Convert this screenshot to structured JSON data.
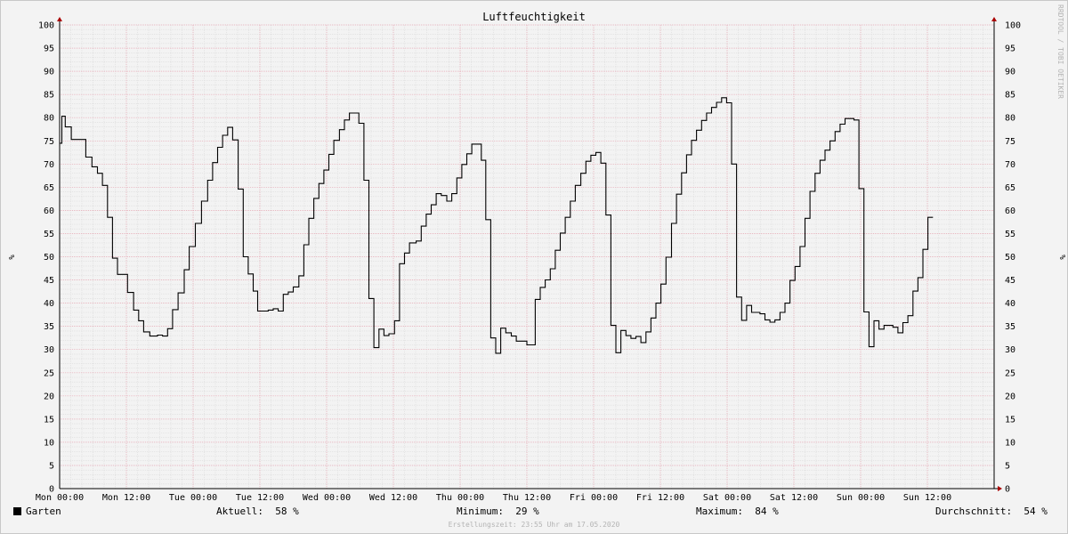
{
  "chart_data": {
    "type": "line",
    "title": "Luftfeuchtigkeit",
    "ylabel": "%",
    "ylim": [
      0,
      100
    ],
    "y_ticks": [
      0,
      5,
      10,
      15,
      20,
      25,
      30,
      35,
      40,
      45,
      50,
      55,
      60,
      65,
      70,
      75,
      80,
      85,
      90,
      95,
      100
    ],
    "x_tick_labels": [
      "Mon 00:00",
      "Mon 12:00",
      "Tue 00:00",
      "Tue 12:00",
      "Wed 00:00",
      "Wed 12:00",
      "Thu 00:00",
      "Thu 12:00",
      "Fri 00:00",
      "Fri 12:00",
      "Sat 00:00",
      "Sat 12:00",
      "Sun 00:00",
      "Sun 12:00"
    ],
    "x_unit": "hours since Mon 00:00",
    "xlim": [
      0,
      168
    ],
    "grid": true,
    "series": [
      {
        "name": "Garten",
        "color": "#000000",
        "step": true,
        "points": [
          [
            0,
            74.5
          ],
          [
            0.4,
            80.3
          ],
          [
            1.0,
            78.0
          ],
          [
            2.1,
            75.3
          ],
          [
            4.7,
            71.5
          ],
          [
            5.8,
            69.4
          ],
          [
            6.8,
            68.0
          ],
          [
            7.7,
            65.4
          ],
          [
            8.6,
            58.5
          ],
          [
            9.5,
            49.7
          ],
          [
            10.4,
            46.2
          ],
          [
            12.2,
            42.3
          ],
          [
            13.3,
            38.5
          ],
          [
            14.2,
            36.2
          ],
          [
            15.1,
            33.8
          ],
          [
            16.2,
            32.9
          ],
          [
            17.6,
            33.1
          ],
          [
            18.5,
            32.9
          ],
          [
            19.4,
            34.5
          ],
          [
            20.3,
            38.6
          ],
          [
            21.3,
            42.2
          ],
          [
            22.4,
            47.2
          ],
          [
            23.3,
            52.2
          ],
          [
            24.4,
            57.2
          ],
          [
            25.5,
            62.0
          ],
          [
            26.6,
            66.5
          ],
          [
            27.5,
            70.3
          ],
          [
            28.4,
            73.6
          ],
          [
            29.3,
            76.2
          ],
          [
            30.2,
            77.9
          ],
          [
            31.1,
            75.2
          ],
          [
            32.1,
            64.6
          ],
          [
            33.0,
            50.0
          ],
          [
            33.9,
            46.3
          ],
          [
            34.8,
            42.6
          ],
          [
            35.6,
            38.3
          ],
          [
            37.5,
            38.5
          ],
          [
            38.4,
            38.8
          ],
          [
            39.3,
            38.3
          ],
          [
            40.2,
            41.9
          ],
          [
            41.1,
            42.4
          ],
          [
            42.0,
            43.5
          ],
          [
            43.0,
            45.9
          ],
          [
            43.9,
            52.6
          ],
          [
            44.8,
            58.3
          ],
          [
            45.7,
            62.6
          ],
          [
            46.6,
            65.8
          ],
          [
            47.5,
            68.7
          ],
          [
            48.4,
            72.1
          ],
          [
            49.3,
            75.1
          ],
          [
            50.3,
            77.4
          ],
          [
            51.2,
            79.5
          ],
          [
            52.1,
            81.0
          ],
          [
            53.8,
            78.8
          ],
          [
            54.7,
            66.5
          ],
          [
            55.6,
            41.0
          ],
          [
            56.5,
            30.4
          ],
          [
            57.4,
            34.4
          ],
          [
            58.3,
            33.0
          ],
          [
            59.2,
            33.4
          ],
          [
            60.2,
            36.2
          ],
          [
            61.1,
            48.5
          ],
          [
            62.0,
            50.8
          ],
          [
            62.9,
            53.0
          ],
          [
            64.1,
            53.4
          ],
          [
            65.0,
            56.6
          ],
          [
            65.9,
            59.2
          ],
          [
            66.8,
            61.2
          ],
          [
            67.7,
            63.6
          ],
          [
            68.6,
            63.2
          ],
          [
            69.6,
            62.0
          ],
          [
            70.5,
            63.6
          ],
          [
            71.4,
            67.0
          ],
          [
            72.3,
            69.9
          ],
          [
            73.2,
            72.2
          ],
          [
            74.1,
            74.3
          ],
          [
            75.8,
            70.8
          ],
          [
            76.6,
            58.0
          ],
          [
            77.5,
            32.5
          ],
          [
            78.4,
            29.2
          ],
          [
            79.3,
            34.6
          ],
          [
            80.2,
            33.6
          ],
          [
            81.2,
            32.9
          ],
          [
            82.1,
            31.8
          ],
          [
            84.0,
            31.0
          ],
          [
            85.5,
            40.8
          ],
          [
            86.4,
            43.4
          ],
          [
            87.3,
            45.0
          ],
          [
            88.2,
            47.4
          ],
          [
            89.1,
            51.4
          ],
          [
            90.0,
            55.1
          ],
          [
            90.9,
            58.5
          ],
          [
            91.8,
            62.0
          ],
          [
            92.7,
            65.4
          ],
          [
            93.7,
            68.0
          ],
          [
            94.6,
            70.6
          ],
          [
            95.5,
            71.9
          ],
          [
            96.4,
            72.5
          ],
          [
            97.3,
            70.2
          ],
          [
            98.2,
            59.0
          ],
          [
            99.1,
            35.2
          ],
          [
            100.0,
            29.3
          ],
          [
            100.9,
            34.1
          ],
          [
            101.8,
            33.0
          ],
          [
            102.7,
            32.4
          ],
          [
            103.6,
            32.8
          ],
          [
            104.5,
            31.5
          ],
          [
            105.4,
            33.8
          ],
          [
            106.3,
            36.8
          ],
          [
            107.2,
            40.0
          ],
          [
            108.1,
            44.1
          ],
          [
            109.0,
            49.9
          ],
          [
            110.0,
            57.2
          ],
          [
            110.9,
            63.5
          ],
          [
            111.8,
            68.1
          ],
          [
            112.7,
            72.0
          ],
          [
            113.6,
            75.1
          ],
          [
            114.5,
            77.3
          ],
          [
            115.4,
            79.4
          ],
          [
            116.3,
            81.0
          ],
          [
            117.2,
            82.2
          ],
          [
            118.1,
            83.3
          ],
          [
            119.0,
            84.3
          ],
          [
            119.9,
            83.2
          ],
          [
            120.8,
            70.0
          ],
          [
            121.7,
            41.3
          ],
          [
            122.6,
            36.3
          ],
          [
            123.5,
            39.5
          ],
          [
            124.4,
            38.0
          ],
          [
            125.9,
            37.7
          ],
          [
            126.8,
            36.4
          ],
          [
            127.7,
            35.9
          ],
          [
            128.6,
            36.4
          ],
          [
            129.5,
            38.0
          ],
          [
            130.4,
            40.0
          ],
          [
            131.3,
            44.9
          ],
          [
            132.2,
            47.9
          ],
          [
            133.1,
            52.2
          ],
          [
            134.0,
            58.3
          ],
          [
            134.9,
            64.1
          ],
          [
            135.8,
            68.0
          ],
          [
            136.7,
            70.8
          ],
          [
            137.6,
            73.0
          ],
          [
            138.5,
            75.0
          ],
          [
            139.4,
            77.0
          ],
          [
            140.3,
            78.6
          ],
          [
            141.2,
            79.8
          ],
          [
            142.8,
            79.5
          ],
          [
            143.7,
            64.7
          ],
          [
            144.6,
            38.1
          ],
          [
            145.5,
            30.6
          ],
          [
            146.4,
            36.2
          ],
          [
            147.3,
            34.4
          ],
          [
            148.2,
            35.2
          ],
          [
            149.8,
            34.8
          ],
          [
            150.7,
            33.6
          ],
          [
            151.6,
            35.8
          ],
          [
            152.5,
            37.3
          ],
          [
            153.4,
            42.6
          ],
          [
            154.3,
            45.5
          ],
          [
            155.2,
            51.6
          ],
          [
            156.1,
            58.5
          ],
          [
            157.0,
            58.5
          ]
        ]
      }
    ]
  },
  "watermark": "RRDTOOL / TOBI OETIKER",
  "footer": {
    "legend_label": "Garten",
    "current_label": "Aktuell:",
    "current_value": "58 %",
    "min_label": "Minimum:",
    "min_value": "29 %",
    "max_label": "Maximum:",
    "max_value": "84 %",
    "avg_label": "Durchschnitt:",
    "avg_value": "54 %",
    "created": "Erstellungszeit: 23:55 Uhr am 17.05.2020"
  }
}
